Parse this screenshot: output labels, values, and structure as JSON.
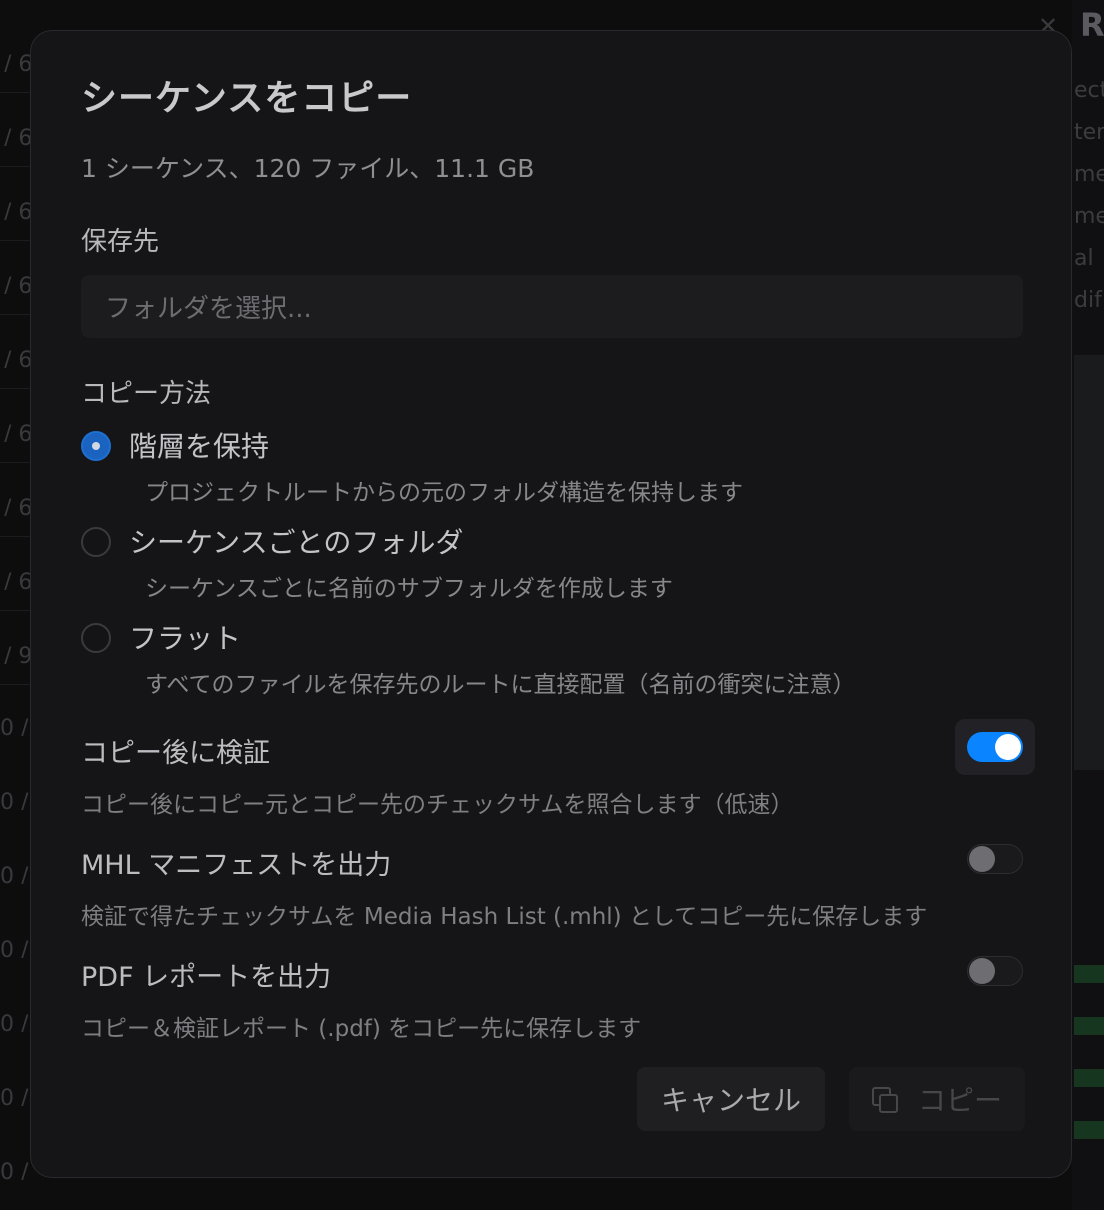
{
  "dialog": {
    "title": "シーケンスをコピー",
    "summary": "1 シーケンス、120 ファイル、11.1 GB",
    "destination": {
      "label": "保存先",
      "placeholder": "フォルダを選択..."
    },
    "copy_method": {
      "label": "コピー方法",
      "options": [
        {
          "label": "階層を保持",
          "description": "プロジェクトルートからの元のフォルダ構造を保持します",
          "selected": true
        },
        {
          "label": "シーケンスごとのフォルダ",
          "description": "シーケンスごとに名前のサブフォルダを作成します",
          "selected": false
        },
        {
          "label": "フラット",
          "description": "すべてのファイルを保存先のルートに直接配置（名前の衝突に注意）",
          "selected": false
        }
      ]
    },
    "toggles": [
      {
        "label": "コピー後に検証",
        "description": "コピー後にコピー元とコピー先のチェックサムを照合します（低速）",
        "on": true
      },
      {
        "label": "MHL マニフェストを出力",
        "description": "検証で得たチェックサムを Media Hash List (.mhl) としてコピー先に保存します",
        "on": false
      },
      {
        "label": "PDF レポートを出力",
        "description": "コピー＆検証レポート (.pdf) をコピー先に保存します",
        "on": false
      }
    ],
    "buttons": {
      "cancel": "キャンセル",
      "copy": "コピー"
    }
  },
  "colors": {
    "accent": "#0a84ff",
    "radio_selected": "#1a63c0",
    "dialog_bg": "#151517"
  }
}
